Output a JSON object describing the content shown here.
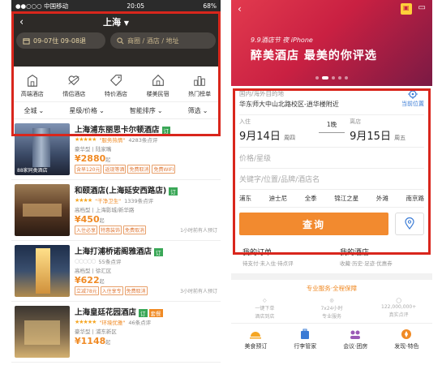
{
  "left": {
    "status_bar": {
      "carrier": "●●○○○ 中国移动",
      "time": "20:05",
      "battery": "68%"
    },
    "city": "上海",
    "dates": "09-07住 09-08退",
    "search_placeholder": "商圈 / 酒店 / 地址",
    "categories": [
      {
        "label": "高端酒店",
        "icon": "building-icon"
      },
      {
        "label": "情侣酒店",
        "icon": "heart-arrow-icon"
      },
      {
        "label": "特价酒店",
        "icon": "price-tag-icon"
      },
      {
        "label": "楼美民宿",
        "icon": "house-icon"
      },
      {
        "label": "热门榜单",
        "icon": "ranking-icon"
      }
    ],
    "filters": [
      "全城",
      "星级/价格",
      "智能排序",
      "筛选"
    ],
    "hotels": [
      {
        "name": "上海浦东丽思卡尔顿酒店",
        "badge": "订",
        "badge2": "",
        "quote": "\"服务热情\"",
        "reviews": "4283条点评",
        "brand": "豪华型 | 陆家嘴",
        "price": "2880",
        "price_unit": "起",
        "tags": [
          "含早120元",
          "返现等酒",
          "免费取消",
          "免费WIFI"
        ],
        "booked": "",
        "caption": "88家同类酒店"
      },
      {
        "name": "和颐酒店(上海延安西路店)",
        "badge": "订",
        "badge2": "",
        "quote": "\"干净卫生\"",
        "reviews": "1339条点评",
        "brand": "高档型 | 上海影城/新华路",
        "price": "450",
        "price_unit": "起",
        "tags": [
          "入住必享",
          "特惠装饰",
          "免费取消"
        ],
        "booked": "1小时前有人预订",
        "caption": ""
      },
      {
        "name": "上海打浦桥诺阁雅酒店",
        "badge": "订",
        "badge2": "",
        "quote": "",
        "reviews": "55条点评",
        "brand": "高档型 | 徐汇区",
        "price": "622",
        "price_unit": "起",
        "tags": [
          "立减78元",
          "入住享专",
          "免费取消"
        ],
        "booked": "3小时前有人预订",
        "caption": ""
      },
      {
        "name": "上海皇廷花园酒店",
        "badge": "订",
        "badge2": "套餐",
        "quote": "\"环境优雅\"",
        "reviews": "46条点评",
        "brand": "豪华型 | 浦东新区",
        "price": "1148",
        "price_unit": "起",
        "tags": [],
        "booked": "",
        "caption": ""
      }
    ]
  },
  "right": {
    "banner": {
      "small": "9.9酒店节 夜 iPhone",
      "big": "醉美酒店 最美的你评选"
    },
    "location_label": "国内/海外目的地",
    "location_value": "华东师大中山北路校区-逍华楼附近",
    "current_location": "当前位置",
    "checkin_label": "入住",
    "checkin_date": "9月14日",
    "checkin_weekday": "周四",
    "nights": "1晚",
    "checkout_label": "离店",
    "checkout_date": "9月15日",
    "checkout_weekday": "周五",
    "price_star_placeholder": "价格/星级",
    "keyword_placeholder": "关键字/位置/品牌/酒店名",
    "hot_tags": [
      "浦东",
      "迪士尼",
      "全季",
      "锦江之星",
      "外滩",
      "南京路"
    ],
    "search_button": "查询",
    "my_orders": {
      "title": "我的订单",
      "sub": "待支付·未入住·待点评"
    },
    "my_hotels": {
      "title": "我的酒店",
      "sub": "收藏·历史·足迹·优惠券"
    },
    "service_title": "专业服务·全程保障",
    "services": [
      {
        "title": "一键下单",
        "sub": "酒店到店"
      },
      {
        "title": "7x24小时",
        "sub": "专业服务"
      },
      {
        "title": "122,000,000+",
        "sub": "真实点评"
      }
    ],
    "bottom_nav": [
      {
        "label": "美食预订",
        "icon": "food-icon"
      },
      {
        "label": "行李管家",
        "icon": "luggage-icon"
      },
      {
        "label": "会议·团房",
        "icon": "meeting-icon"
      },
      {
        "label": "发现·特色",
        "icon": "discover-icon"
      }
    ]
  },
  "colors": {
    "accent": "#f08a24",
    "highlight_border": "#d9261c",
    "dark_header": "#2d2a27",
    "banner_red": "#c92042"
  }
}
